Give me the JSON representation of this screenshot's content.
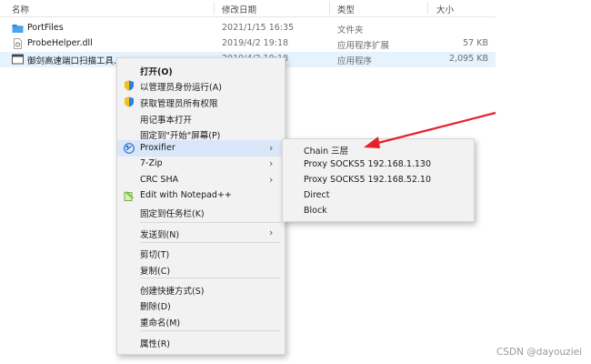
{
  "header": {
    "columns": [
      "名称",
      "修改日期",
      "类型",
      "大小"
    ]
  },
  "files": [
    {
      "name": "PortFiles",
      "date": "2021/1/15 16:35",
      "type": "文件夹",
      "size": "",
      "icon": "folder-icon"
    },
    {
      "name": "ProbeHelper.dll",
      "date": "2019/4/2 19:18",
      "type": "应用程序扩展",
      "size": "57 KB",
      "icon": "dll-file-icon"
    },
    {
      "name": "御剑高速端口扫描工具.exe",
      "date": "2019/4/2 19:18",
      "type": "应用程序",
      "size": "2,095 KB",
      "icon": "exe-window-icon"
    }
  ],
  "menu": {
    "open": "打开(O)",
    "run_as_admin": "以管理员身份运行(A)",
    "take_ownership": "获取管理员所有权限",
    "open_notepad": "用记事本打开",
    "pin_start": "固定到\"开始\"屏幕(P)",
    "proxifier": "Proxifier",
    "zip": "7-Zip",
    "crc": "CRC SHA",
    "edit_npp": "Edit with Notepad++",
    "pin_taskbar": "固定到任务栏(K)",
    "send_to": "发送到(N)",
    "cut": "剪切(T)",
    "copy": "复制(C)",
    "create_shortcut": "创建快捷方式(S)",
    "delete": "删除(D)",
    "rename": "重命名(M)",
    "properties": "属性(R)"
  },
  "submenu": {
    "items": [
      "Chain 三层",
      "Proxy SOCKS5 192.168.1.130",
      "Proxy SOCKS5 192.168.52.10",
      "Direct",
      "Block"
    ]
  },
  "colors": {
    "accent": "#0078d7",
    "highlight": "#d9e7f8",
    "arrow": "#e8202a"
  },
  "watermark": "CSDN @dayouziei"
}
